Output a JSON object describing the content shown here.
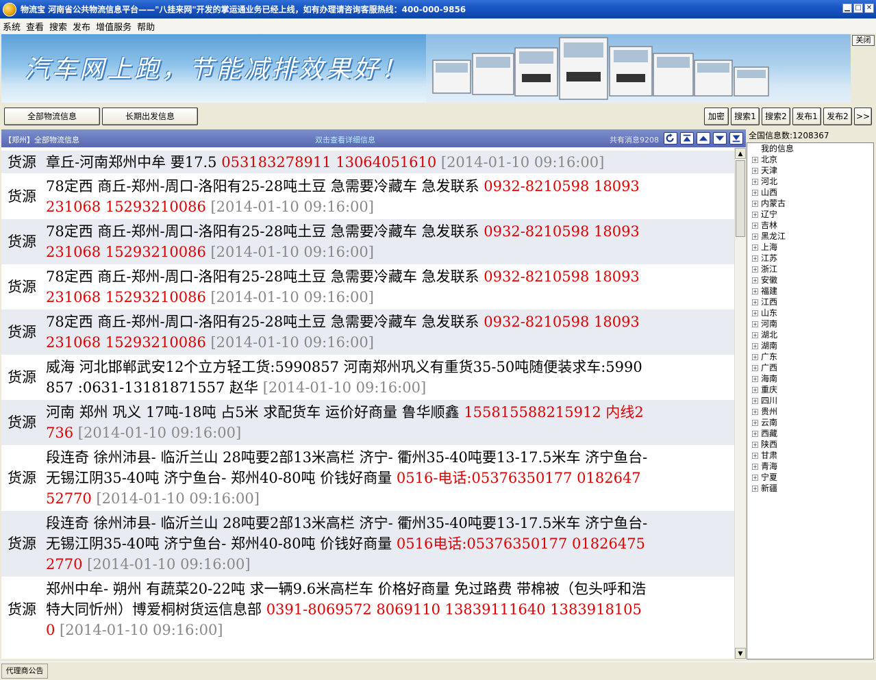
{
  "window": {
    "title": "物流宝  河南省公共物流信息平台——\"八挂来网\"开发的掌运通业务已经上线，如有办理请咨询客服热线：400-000-9856",
    "controls": [
      "▁",
      "□",
      "✕"
    ]
  },
  "menu": [
    "系统",
    "查看",
    "搜索",
    "发布",
    "增值服务",
    "帮助"
  ],
  "banner": {
    "slogan": "汽车网上跑，节能减排效果好！",
    "close_label": "关闭"
  },
  "toolbar": {
    "tab_all": "全部物流信息",
    "tab_long": "长期出发信息",
    "buttons": [
      "加密",
      "搜索1",
      "搜索2",
      "发布1",
      "发布2",
      ">>"
    ]
  },
  "list_header": {
    "location": "【郑州】全部物流信息",
    "hint": "双击查看详细信息",
    "count": "共有消息9208"
  },
  "rows": [
    {
      "tag": "货源",
      "text": "章丘-河南郑州中牟 要17.5  ",
      "phone": "053183278911 13064051610",
      "time": " [2014-01-10 09:16:00]"
    },
    {
      "tag": "货源",
      "text": "78定西 商丘-郑州-周口-洛阳有25-28吨土豆 急需要冷藏车 急发联系  ",
      "phone": "0932-8210598 18093231068 15293210086",
      "time": " [2014-01-10 09:16:00]"
    },
    {
      "tag": "货源",
      "text": "78定西 商丘-郑州-周口-洛阳有25-28吨土豆 急需要冷藏车 急发联系  ",
      "phone": "0932-8210598 18093231068 15293210086",
      "time": " [2014-01-10 09:16:00]"
    },
    {
      "tag": "货源",
      "text": "78定西 商丘-郑州-周口-洛阳有25-28吨土豆 急需要冷藏车 急发联系  ",
      "phone": "0932-8210598 18093231068 15293210086",
      "time": " [2014-01-10 09:16:00]"
    },
    {
      "tag": "货源",
      "text": "78定西 商丘-郑州-周口-洛阳有25-28吨土豆 急需要冷藏车 急发联系  ",
      "phone": "0932-8210598 18093231068 15293210086",
      "time": " [2014-01-10 09:16:00]"
    },
    {
      "tag": "货源",
      "text": "威海 河北邯郸武安12个立方轻工货:5990857 河南郑州巩义有重货35-50吨随便装求车:5990857 :0631-13181871557 赵华  ",
      "phone": "",
      "time": " [2014-01-10 09:16:00]"
    },
    {
      "tag": "货源",
      "text": "河南 郑州 巩义 17吨-18吨 占5米 求配货车 运价好商量 鲁华顺鑫  ",
      "phone": "155815588215912 内线2736",
      "time": " [2014-01-10 09:16:00]"
    },
    {
      "tag": "货源",
      "text": "段连奇 徐州沛县- 临沂兰山 28吨要2部13米高栏 济宁- 衢州35-40吨要13-17.5米车 济宁鱼台- 无锡江阴35-40吨 济宁鱼台- 郑州40-80吨 价钱好商量  ",
      "phone": "0516-电话:05376350177 018264752770",
      "time": " [2014-01-10 09:16:00]"
    },
    {
      "tag": "货源",
      "text": "段连奇 徐州沛县- 临沂兰山 28吨要2部13米高栏 济宁- 衢州35-40吨要13-17.5米车 济宁鱼台- 无锡江阴35-40吨 济宁鱼台- 郑州40-80吨 价钱好商量  ",
      "phone": "0516电话:05376350177 018264752770",
      "time": " [2014-01-10 09:16:00]"
    },
    {
      "tag": "货源",
      "text": "郑州中牟- 朔州 有蔬菜20-22吨 求一辆9.6米高栏车 价格好商量 免过路费 带棉被（包头呼和浩特大同忻州）博爱桐树货运信息部  ",
      "phone": "0391-8069572 8069110 13839111640 13839181050",
      "time": " [2014-01-10 09:16:00]"
    }
  ],
  "national_count": "全国信息数:1208367",
  "tree": {
    "root": "我的信息",
    "provinces": [
      "北京",
      "天津",
      "河北",
      "山西",
      "内蒙古",
      "辽宁",
      "吉林",
      "黑龙江",
      "上海",
      "江苏",
      "浙江",
      "安徽",
      "福建",
      "江西",
      "山东",
      "河南",
      "湖北",
      "湖南",
      "广东",
      "广西",
      "海南",
      "重庆",
      "四川",
      "贵州",
      "云南",
      "西藏",
      "陕西",
      "甘肃",
      "青海",
      "宁夏",
      "新疆"
    ]
  },
  "status": {
    "agent_notice": "代理商公告"
  },
  "colors": {
    "phone": "#e00000",
    "header": "#5868b4",
    "title": "#1a56c4"
  }
}
